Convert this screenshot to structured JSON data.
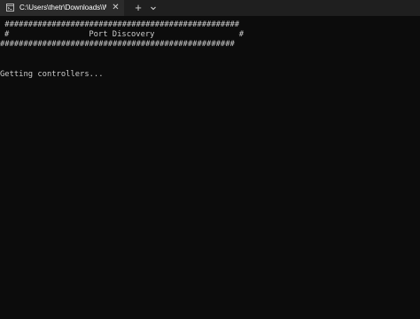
{
  "tab": {
    "title": "C:\\Users\\thetr\\Downloads\\Wi",
    "close_glyph": "✕",
    "icon": "terminal-icon"
  },
  "toolbar": {
    "new_tab_glyph": "+",
    "dropdown_icon": "chevron-down-icon"
  },
  "terminal": {
    "lines": [
      " ##################################################",
      "#                 Port Discovery                  #",
      "##################################################",
      "",
      "",
      "Getting controllers..."
    ]
  },
  "colors": {
    "background": "#0c0c0c",
    "text": "#cccccc",
    "tab_active": "#2b2b2b",
    "tabbar": "#1f1f1f"
  }
}
